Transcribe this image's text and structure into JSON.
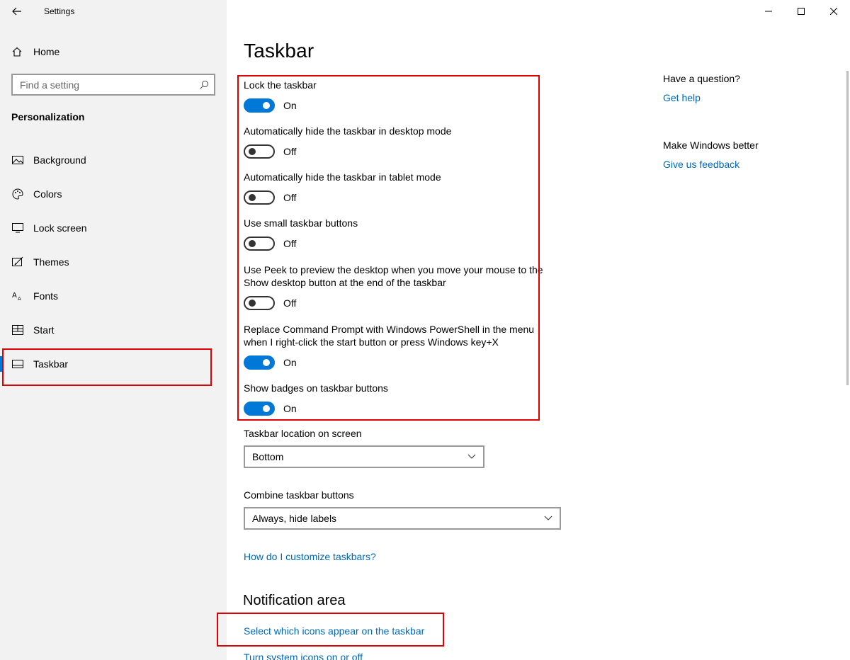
{
  "window": {
    "app_title": "Settings",
    "back_icon": "back-arrow-icon",
    "controls": [
      "minimize-icon",
      "maximize-icon",
      "close-icon"
    ]
  },
  "sidebar": {
    "home_label": "Home",
    "search_placeholder": "Find a setting",
    "section_heading": "Personalization",
    "items": [
      {
        "label": "Background",
        "icon": "picture-icon"
      },
      {
        "label": "Colors",
        "icon": "palette-icon"
      },
      {
        "label": "Lock screen",
        "icon": "monitor-icon"
      },
      {
        "label": "Themes",
        "icon": "brush-icon"
      },
      {
        "label": "Fonts",
        "icon": "font-icon"
      },
      {
        "label": "Start",
        "icon": "start-grid-icon"
      },
      {
        "label": "Taskbar",
        "icon": "taskbar-icon",
        "active": true
      }
    ]
  },
  "main": {
    "title": "Taskbar",
    "settings": [
      {
        "label": "Lock the taskbar",
        "state": "On"
      },
      {
        "label": "Automatically hide the taskbar in desktop mode",
        "state": "Off"
      },
      {
        "label": "Automatically hide the taskbar in tablet mode",
        "state": "Off"
      },
      {
        "label": "Use small taskbar buttons",
        "state": "Off"
      },
      {
        "label_line1": "Use Peek to preview the desktop when you move your mouse to the",
        "label_line2": "Show desktop button at the end of the taskbar",
        "state": "Off"
      },
      {
        "label_line1": "Replace Command Prompt with Windows PowerShell in the menu",
        "label_line2": "when I right-click the start button or press Windows key+X",
        "state": "On"
      },
      {
        "label": "Show badges on taskbar buttons",
        "state": "On"
      }
    ],
    "location": {
      "label": "Taskbar location on screen",
      "value": "Bottom"
    },
    "combine": {
      "label": "Combine taskbar buttons",
      "value": "Always, hide labels"
    },
    "customize_link": "How do I customize taskbars?",
    "notification_heading": "Notification area",
    "notification_links": [
      "Select which icons appear on the taskbar",
      "Turn system icons on or off"
    ]
  },
  "side_panel": {
    "question": "Have a question?",
    "help_link": "Get help",
    "improve": "Make Windows better",
    "feedback_link": "Give us feedback"
  },
  "colors": {
    "accent": "#0078d7",
    "link": "#0067b8",
    "highlight": "#e00000"
  }
}
